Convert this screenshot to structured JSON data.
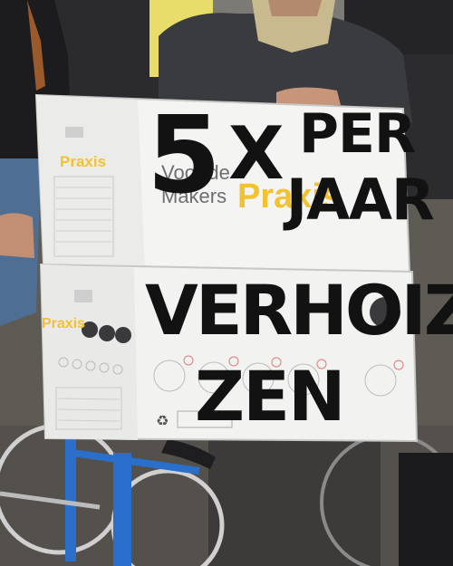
{
  "photo": {
    "sign_top": {
      "big_number": "5",
      "word_x": "X",
      "word_per": "PER",
      "word_jaar": "JAAR"
    },
    "sign_bottom": {
      "line1": "VERHOIZ",
      "line2": "ZEN"
    },
    "box_print": {
      "brand_top": "Praxis",
      "brand_bottom": "Praxis",
      "slogan_line1": "Voor de",
      "slogan_line2": "Makers",
      "slogan_brand": "Praxis"
    },
    "colors": {
      "praxis_yellow": "#f2c230",
      "box_white": "#f4f4f2",
      "marker_black": "#121212",
      "bike_blue": "#2a6fc9",
      "sweater": "#3a3b3f"
    }
  }
}
